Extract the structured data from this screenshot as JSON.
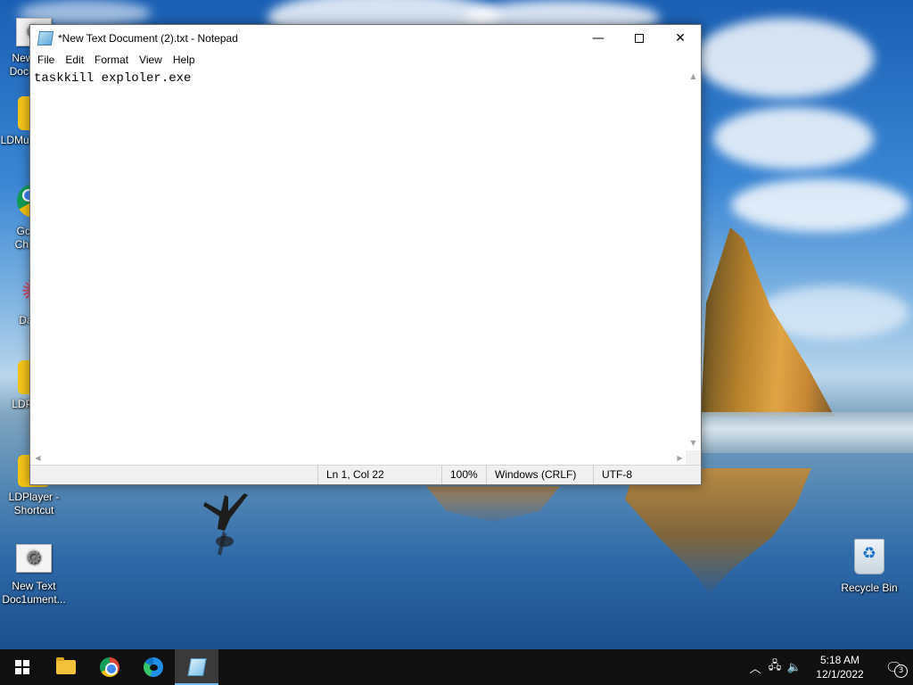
{
  "desktop": {
    "icons": [
      {
        "label": "New Text Document"
      },
      {
        "label": "LDMultiPlayer"
      },
      {
        "label": "Google Chrome"
      },
      {
        "label": "DataV"
      },
      {
        "label": "LDPlayer"
      },
      {
        "label": "LDPlayer - Shortcut"
      },
      {
        "label": "New Text Doc1ument..."
      },
      {
        "label": "Recycle Bin"
      }
    ]
  },
  "notepad": {
    "title": "*New Text Document (2).txt - Notepad",
    "menu": [
      "File",
      "Edit",
      "Format",
      "View",
      "Help"
    ],
    "content": "taskkill exploler.exe",
    "status": {
      "position": "Ln 1, Col 22",
      "zoom": "100%",
      "line_ending": "Windows (CRLF)",
      "encoding": "UTF-8"
    }
  },
  "taskbar": {
    "clock_time": "5:18 AM",
    "clock_date": "12/1/2022",
    "notification_count": "3"
  }
}
